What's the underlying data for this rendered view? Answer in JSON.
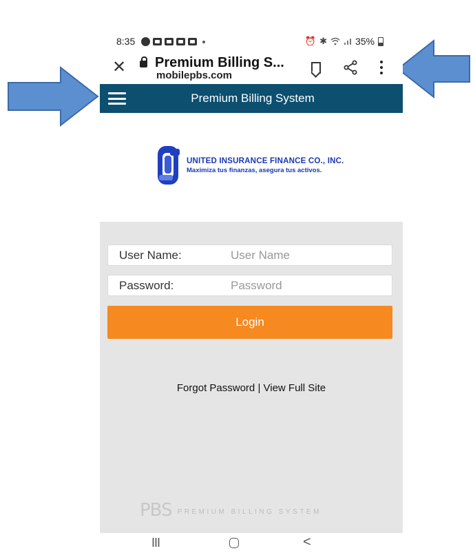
{
  "status_bar": {
    "time": "8:35",
    "battery": "35%"
  },
  "browser": {
    "page_title": "Premium Billing S...",
    "url": "mobilepbs.com",
    "icons": [
      "close-icon",
      "lock-icon",
      "bookmark-icon",
      "share-icon",
      "more-vert-icon"
    ]
  },
  "app_header": {
    "title": "Premium Billing System",
    "menu_icon": "hamburger-menu-icon",
    "color": "#0c4f6f"
  },
  "logo": {
    "company": "UNITED INSURANCE FINANCE CO., INC.",
    "slogan": "Maximiza tus finanzas, asegura tus activos."
  },
  "login_form": {
    "username_label": "User Name:",
    "username_placeholder": "User Name",
    "password_label": "Password:",
    "password_placeholder": "Password",
    "login_label": "Login",
    "button_color": "#f6891f"
  },
  "links": {
    "forgot_password": "Forgot Password",
    "separator": " | ",
    "full_site": "View Full Site"
  },
  "footer": {
    "brand_mark": "PBS",
    "brand_text": "PREMIUM BILLING SYSTEM"
  },
  "nav_bar": {
    "recents_glyph": "III",
    "back_glyph": "<"
  },
  "annotations": {
    "arrow_color": "#5b8fd0"
  }
}
